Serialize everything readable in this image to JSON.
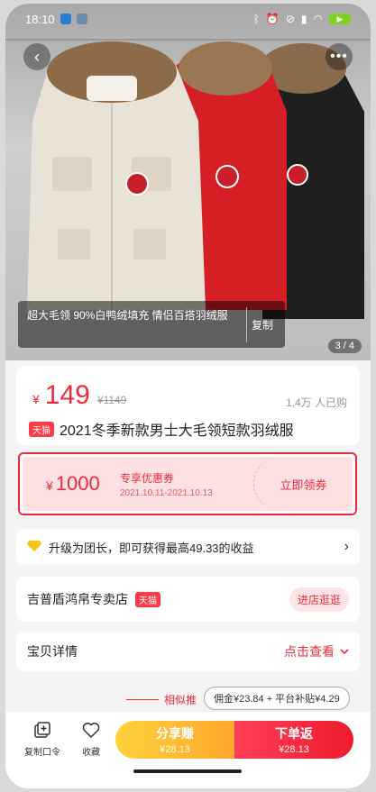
{
  "status_bar": {
    "time": "18:10"
  },
  "gallery": {
    "caption": "超大毛领 90%白鸭绒填充 情侣百搭羽绒服",
    "copy_label": "复制",
    "pager": "3 / 4",
    "jacket_colors": [
      "#e9e2d6",
      "#d51f25",
      "#1f1f1f"
    ]
  },
  "product": {
    "currency": "¥",
    "price": "149",
    "original_price": "¥1149",
    "sold": "1.4万 人已购",
    "tag": "天猫",
    "title": "2021冬季新款男士大毛领短款羽绒服"
  },
  "coupon": {
    "currency": "¥",
    "amount": "1000",
    "name": "专享优惠券",
    "date_range": "2021.10.11-2021.10.13",
    "claim_label": "立即领券"
  },
  "upgrade": {
    "text": "升级为团长，即可获得最高49.33的收益"
  },
  "store": {
    "name": "吉普盾鸿帛专卖店",
    "tag": "天猫",
    "enter_label": "进店逛逛"
  },
  "details": {
    "label": "宝贝详情",
    "view_label": "点击查看"
  },
  "similar": {
    "label": "相似推"
  },
  "commission": {
    "text": "佣金¥23.84 + 平台补贴¥4.29"
  },
  "bottom_bar": {
    "copy_code": "复制口令",
    "favorite": "收藏",
    "share_label": "分享赚",
    "share_amount": "¥28.13",
    "order_label": "下单返",
    "order_amount": "¥28.13"
  },
  "colors": {
    "accent": "#ee2a3d",
    "share_gradient": [
      "#ffd23c",
      "#ffa62b"
    ]
  }
}
